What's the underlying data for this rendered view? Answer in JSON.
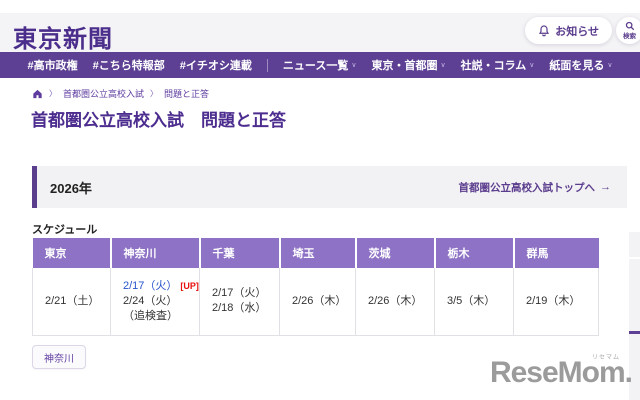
{
  "brand": {
    "logo_text": "東京新聞"
  },
  "header": {
    "notice_button": "お知らせ",
    "search_button": "検索"
  },
  "nav": {
    "hash_items": [
      "#高市政権",
      "#こちら特報部",
      "#イチオシ連載"
    ],
    "menu_items": [
      "ニュース一覧",
      "東京・首都圏",
      "社説・コラム",
      "紙面を見る"
    ],
    "chevron": "∨"
  },
  "breadcrumb": {
    "sep": "〉",
    "items": [
      "首都圏公立高校入試",
      "問題と正答"
    ]
  },
  "page": {
    "title": "首都圏公立高校入試　問題と正答"
  },
  "year_box": {
    "year": "2026年",
    "link_label": "首都圏公立高校入試トップへ",
    "arrow": "→"
  },
  "schedule": {
    "label": "スケジュール",
    "columns": [
      "東京",
      "神奈川",
      "千葉",
      "埼玉",
      "茨城",
      "栃木",
      "群馬"
    ],
    "cells": {
      "tokyo": "2/21（土）",
      "kanagawa": {
        "link": "2/17（火）",
        "up": "[UP]",
        "line2": "2/24（火）",
        "line3": "（追検査）"
      },
      "chiba": {
        "line1": "2/17（火）",
        "line2": "2/18（水）"
      },
      "saitama": "2/26（木）",
      "ibaraki": "2/26（木）",
      "tochigi": "3/5（木）",
      "gunma": "2/19（木）"
    }
  },
  "tags": {
    "kanagawa": "神奈川"
  },
  "watermark": {
    "text": "ReseMom.",
    "ruby": "リセマム"
  },
  "colors": {
    "brand_purple": "#5d4094",
    "logo_purple": "#4b2e8c",
    "table_header_purple": "#8d72c5",
    "link_blue": "#2753cc",
    "up_red": "#e8100c",
    "band_gray": "#f4f3f5",
    "box_gray": "#f2f1f3"
  }
}
